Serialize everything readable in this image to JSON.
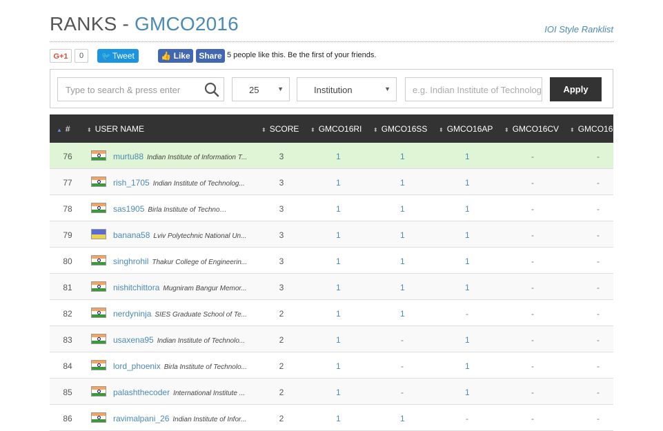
{
  "header": {
    "title_prefix": "RANKS - ",
    "contest_code": "GMCO2016",
    "ioi_link": "IOI Style Ranklist"
  },
  "social": {
    "gplus_label": "G+1",
    "gplus_count": "0",
    "tweet_label": "Tweet",
    "fb_like_label": "Like",
    "fb_share_label": "Share",
    "fb_text": "5 people like this. Be the first of your friends."
  },
  "filters": {
    "search_placeholder": "Type to search & press enter",
    "page_size": "25",
    "filter_by": "Institution",
    "institution_placeholder": "e.g. Indian Institute of Technology",
    "apply_label": "Apply"
  },
  "table": {
    "columns": [
      "#",
      "USER NAME",
      "SCORE",
      "GMCO16RI",
      "GMCO16SS",
      "GMCO16AP",
      "GMCO16CV",
      "GMCO16"
    ],
    "rows": [
      {
        "rank": "76",
        "flag": "india",
        "user": "murtu88",
        "inst": "Indian Institute of Information T...",
        "score": "3",
        "p": [
          "1",
          "1",
          "1",
          "-",
          "-"
        ]
      },
      {
        "rank": "77",
        "flag": "india",
        "user": "rish_1705",
        "inst": "Indian Institute of Technolog...",
        "score": "3",
        "p": [
          "1",
          "1",
          "1",
          "-",
          "-"
        ]
      },
      {
        "rank": "78",
        "flag": "india",
        "user": "sas1905",
        "inst": "Birla Institute of Technology M...",
        "score": "3",
        "p": [
          "1",
          "1",
          "1",
          "-",
          "-"
        ]
      },
      {
        "rank": "79",
        "flag": "ukraine",
        "user": "banana58",
        "inst": "Lviv Polytechnic National Un...",
        "score": "3",
        "p": [
          "1",
          "1",
          "1",
          "-",
          "-"
        ]
      },
      {
        "rank": "80",
        "flag": "india",
        "user": "singhrohil",
        "inst": "Thakur College of Engineerin...",
        "score": "3",
        "p": [
          "1",
          "1",
          "1",
          "-",
          "-"
        ]
      },
      {
        "rank": "81",
        "flag": "india",
        "user": "nishitchittora",
        "inst": "Mugniram Bangur Memor...",
        "score": "3",
        "p": [
          "1",
          "1",
          "1",
          "-",
          "-"
        ]
      },
      {
        "rank": "82",
        "flag": "india",
        "user": "nerdyninja",
        "inst": "SIES Graduate School of Te...",
        "score": "2",
        "p": [
          "1",
          "1",
          "-",
          "-",
          "-"
        ]
      },
      {
        "rank": "83",
        "flag": "india",
        "user": "usaxena95",
        "inst": "Indian Institute of Technolo...",
        "score": "2",
        "p": [
          "1",
          "-",
          "1",
          "-",
          "-"
        ]
      },
      {
        "rank": "84",
        "flag": "india",
        "user": "lord_phoenix",
        "inst": "Birla Institute of Technolo...",
        "score": "2",
        "p": [
          "1",
          "-",
          "1",
          "-",
          "-"
        ]
      },
      {
        "rank": "85",
        "flag": "india",
        "user": "palashthecoder",
        "inst": "International Institute ...",
        "score": "2",
        "p": [
          "1",
          "-",
          "1",
          "-",
          "-"
        ]
      },
      {
        "rank": "86",
        "flag": "india",
        "user": "ravimalpani_26",
        "inst": "Indian Institute of Infor...",
        "score": "2",
        "p": [
          "1",
          "1",
          "-",
          "-",
          "-"
        ]
      }
    ]
  },
  "colors": {
    "link": "#4a8ab3",
    "header_bg": "#333333",
    "highlight_row": "#dff5d6",
    "apply_bg": "#333333"
  }
}
